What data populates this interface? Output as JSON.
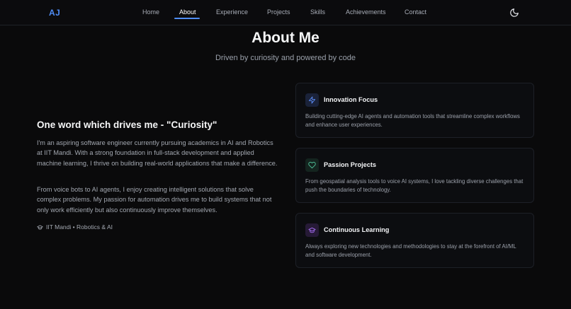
{
  "nav": {
    "logo": "AJ",
    "links": [
      "Home",
      "About",
      "Experience",
      "Projects",
      "Skills",
      "Achievements",
      "Contact"
    ],
    "active": "About",
    "theme_toggle_icon": "moon-icon",
    "accent_color": "#4f8df6"
  },
  "header": {
    "title": "About Me",
    "subtitle": "Driven by curiosity and powered by code"
  },
  "about": {
    "heading": "One word which drives me - \"Curiosity\"",
    "paragraph1": "I'm an aspiring software engineer currently pursuing academics in AI and Robotics at IIT Mandi. With a strong foundation in full-stack development and applied machine learning, I thrive on building real-world applications that make a difference.",
    "paragraph2": "From voice bots to AI agents, I enjoy creating intelligent solutions that solve complex problems. My passion for automation drives me to build systems that not only work efficiently but also continuously improve themselves.",
    "education_icon": "graduation-cap-icon",
    "education": "IIT Mandi • Robotics & AI"
  },
  "cards": [
    {
      "icon": "lightning-icon",
      "icon_color": "#5b8cf5",
      "title": "Innovation Focus",
      "description": "Building cutting-edge AI agents and automation tools that streamline complex workflows and enhance user experiences."
    },
    {
      "icon": "heart-icon",
      "icon_color": "#4fbf97",
      "title": "Passion Projects",
      "description": "From geospatial analysis tools to voice AI systems, I love tackling diverse challenges that push the boundaries of technology."
    },
    {
      "icon": "graduation-cap-icon",
      "icon_color": "#a46bf0",
      "title": "Continuous Learning",
      "description": "Always exploring new technologies and methodologies to stay at the forefront of AI/ML and software development."
    }
  ]
}
